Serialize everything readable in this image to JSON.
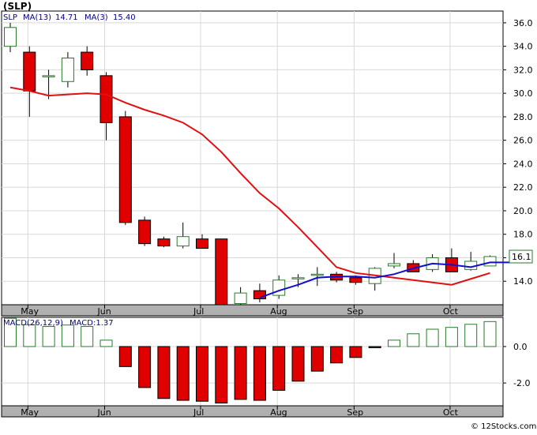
{
  "title": "(SLP)",
  "watermark": "© 12Stocks.com",
  "colors": {
    "up": "#2a7a2a",
    "down": "#e00000",
    "ma_slow": "#e01010",
    "ma_fast": "#1010cc",
    "grid": "#d8d8d8",
    "panel": "#b0b0b0"
  },
  "chart_data": [
    {
      "type": "candlestick",
      "legend": {
        "symbol": "SLP",
        "ma13_label": "MA(13)",
        "ma13_value": "14.71",
        "ma3_label": "MA(3)",
        "ma3_value": "15.40"
      },
      "ylim": [
        12.0,
        37.0
      ],
      "yticks": [
        "36.0",
        "34.0",
        "32.0",
        "30.0",
        "28.0",
        "26.0",
        "24.0",
        "22.0",
        "20.0",
        "18.0",
        "16.0",
        "14.0"
      ],
      "ytick_values": [
        36,
        34,
        32,
        30,
        28,
        26,
        24,
        22,
        20,
        18,
        16,
        14
      ],
      "xlabels": [
        {
          "label": "May",
          "i": 1
        },
        {
          "label": "Jun",
          "i": 5
        },
        {
          "label": "Jul",
          "i": 10
        },
        {
          "label": "Aug",
          "i": 14
        },
        {
          "label": "Sep",
          "i": 18
        },
        {
          "label": "Oct",
          "i": 23
        }
      ],
      "last_price_label": "16.1",
      "last_price": 16.1,
      "candles": [
        {
          "o": 34.0,
          "h": 36.0,
          "l": 33.5,
          "c": 35.6
        },
        {
          "o": 33.5,
          "h": 34.0,
          "l": 28.0,
          "c": 30.2
        },
        {
          "o": 31.5,
          "h": 32.0,
          "l": 29.5,
          "c": 31.5
        },
        {
          "o": 31.0,
          "h": 33.5,
          "l": 30.5,
          "c": 33.0
        },
        {
          "o": 33.5,
          "h": 34.0,
          "l": 31.5,
          "c": 32.0
        },
        {
          "o": 31.5,
          "h": 31.8,
          "l": 26.0,
          "c": 27.5
        },
        {
          "o": 28.0,
          "h": 28.5,
          "l": 18.8,
          "c": 19.0
        },
        {
          "o": 19.2,
          "h": 19.5,
          "l": 17.0,
          "c": 17.2
        },
        {
          "o": 17.6,
          "h": 17.8,
          "l": 16.9,
          "c": 17.0
        },
        {
          "o": 17.0,
          "h": 19.0,
          "l": 16.8,
          "c": 17.8
        },
        {
          "o": 17.6,
          "h": 18.0,
          "l": 16.8,
          "c": 16.8
        },
        {
          "o": 17.6,
          "h": 17.6,
          "l": 12.0,
          "c": 12.0
        },
        {
          "o": 12.1,
          "h": 13.5,
          "l": 12.0,
          "c": 13.0
        },
        {
          "o": 13.2,
          "h": 13.8,
          "l": 12.2,
          "c": 12.5
        },
        {
          "o": 12.8,
          "h": 14.5,
          "l": 12.5,
          "c": 14.1
        },
        {
          "o": 14.2,
          "h": 14.6,
          "l": 13.5,
          "c": 14.3
        },
        {
          "o": 14.5,
          "h": 15.2,
          "l": 13.6,
          "c": 14.6
        },
        {
          "o": 14.6,
          "h": 14.8,
          "l": 13.9,
          "c": 14.1
        },
        {
          "o": 14.3,
          "h": 14.5,
          "l": 13.7,
          "c": 13.9
        },
        {
          "o": 13.8,
          "h": 15.2,
          "l": 13.2,
          "c": 15.1
        },
        {
          "o": 15.3,
          "h": 16.4,
          "l": 15.1,
          "c": 15.5
        },
        {
          "o": 15.5,
          "h": 15.8,
          "l": 14.8,
          "c": 14.8
        },
        {
          "o": 15.0,
          "h": 16.3,
          "l": 14.8,
          "c": 16.0
        },
        {
          "o": 16.0,
          "h": 16.8,
          "l": 14.8,
          "c": 14.8
        },
        {
          "o": 15.0,
          "h": 16.5,
          "l": 14.9,
          "c": 15.7
        },
        {
          "o": 15.3,
          "h": 16.2,
          "l": 15.3,
          "c": 16.1
        }
      ],
      "ma_slow": [
        30.5,
        30.2,
        29.8,
        29.9,
        30.0,
        29.9,
        29.2,
        28.6,
        28.1,
        27.5,
        26.5,
        25.0,
        23.2,
        21.5,
        20.2,
        18.6,
        16.9,
        15.2,
        14.7,
        14.5,
        14.3,
        14.1,
        13.9,
        13.7,
        14.2,
        14.7
      ],
      "ma_fast_start": 13,
      "ma_fast": [
        12.6,
        13.2,
        13.7,
        14.3,
        14.4,
        14.4,
        14.3,
        14.6,
        15.1,
        15.5,
        15.4,
        15.2,
        15.6,
        15.6
      ]
    },
    {
      "type": "bar",
      "legend": {
        "label": "MACD(26,12,9)",
        "value_label": "MACD:1.37"
      },
      "ylim": [
        -3.25,
        1.6
      ],
      "yticks": [
        "0.0",
        "-2.0"
      ],
      "ytick_values": [
        0.0,
        -2.0
      ],
      "values": [
        1.55,
        1.2,
        1.1,
        1.18,
        1.1,
        0.35,
        -1.1,
        -2.25,
        -2.85,
        -2.95,
        -3.0,
        -3.1,
        -2.9,
        -2.95,
        -2.4,
        -1.9,
        -1.35,
        -0.9,
        -0.6,
        -0.05,
        0.35,
        0.7,
        0.95,
        1.05,
        1.22,
        1.37
      ]
    }
  ]
}
